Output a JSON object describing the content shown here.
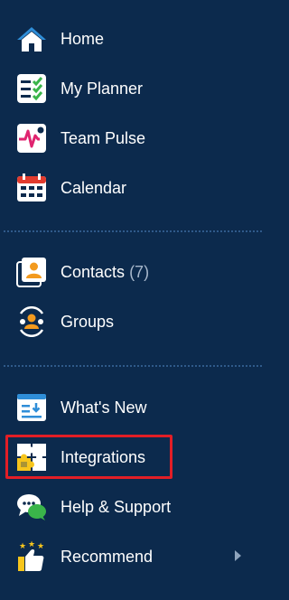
{
  "colors": {
    "background": "#0c2a4d",
    "highlight_border": "#e21e26",
    "icon_blue": "#2f8ed8",
    "icon_green": "#3ab54a",
    "icon_pink": "#e0246f",
    "icon_orange": "#f39a1e",
    "icon_yellow": "#f7c51c",
    "divider": "#2f5a8a"
  },
  "nav": {
    "primary": [
      {
        "label": "Home",
        "icon": "home-icon"
      },
      {
        "label": "My Planner",
        "icon": "planner-checklist-icon"
      },
      {
        "label": "Team Pulse",
        "icon": "pulse-icon"
      },
      {
        "label": "Calendar",
        "icon": "calendar-icon"
      }
    ],
    "people": [
      {
        "label": "Contacts",
        "count": "(7)",
        "icon": "contacts-icon"
      },
      {
        "label": "Groups",
        "icon": "groups-icon"
      }
    ],
    "other": [
      {
        "label": "What's New",
        "icon": "whats-new-icon"
      },
      {
        "label": "Integrations",
        "icon": "puzzle-icon",
        "highlighted": true
      },
      {
        "label": "Help & Support",
        "icon": "chat-bubbles-icon"
      },
      {
        "label": "Recommend",
        "icon": "thumbs-up-stars-icon",
        "has_submenu": true
      }
    ]
  }
}
